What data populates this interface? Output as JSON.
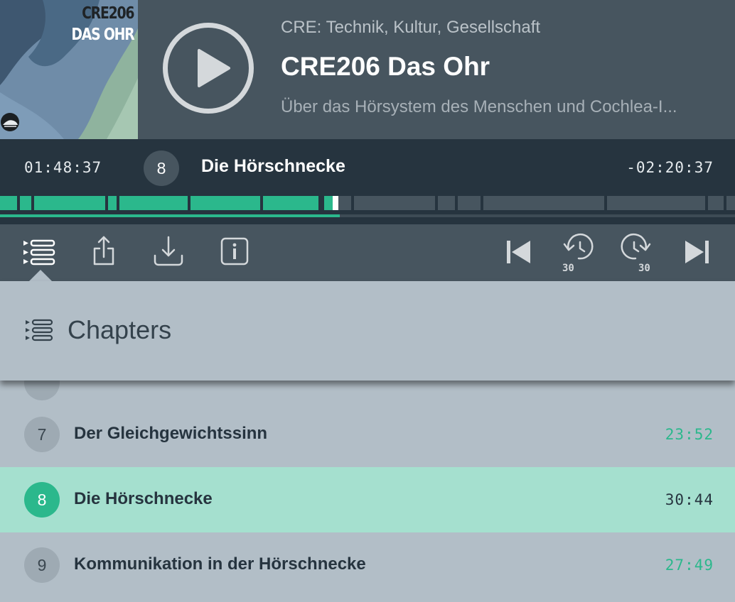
{
  "cover": {
    "line1": "CRE206",
    "line2": "DAS OHR",
    "logo_icon": "cre-logo-icon"
  },
  "episode": {
    "show": "CRE: Technik, Kultur, Gesellschaft",
    "title": "CRE206 Das Ohr",
    "subtitle": "Über das Hörsystem des Menschen und Cochlea-I..."
  },
  "player": {
    "elapsed": "01:48:37",
    "remaining": "-02:20:37",
    "current_chapter_number": "8",
    "current_chapter_title": "Die Hörschnecke",
    "progress_fraction": 0.46,
    "played_color": "#2bb88c",
    "unplayed_color": "#47555f"
  },
  "toolbar": {
    "left": [
      "chapters-list-icon",
      "share-icon",
      "download-icon",
      "info-icon"
    ],
    "right": [
      "previous-chapter-icon",
      "rewind-30-icon",
      "forward-30-icon",
      "next-chapter-icon"
    ],
    "skip_seconds": "30"
  },
  "chapters_panel": {
    "title": "Chapters"
  },
  "chapters": [
    {
      "number": "7",
      "title": "Der Gleichgewichtssinn",
      "duration": "23:52",
      "active": false
    },
    {
      "number": "8",
      "title": "Die Hörschnecke",
      "duration": "30:44",
      "active": true
    },
    {
      "number": "9",
      "title": "Kommunikation in der Hörschnecke",
      "duration": "27:49",
      "active": false
    }
  ]
}
